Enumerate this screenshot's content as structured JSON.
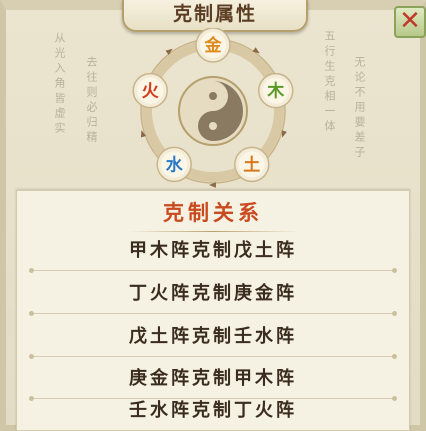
{
  "title": "克制属性",
  "close_label": "✕",
  "side_texts": [
    "从光入角皆虚实",
    "去往则必归精",
    "五行生克相一体",
    "无论不用要差子"
  ],
  "elements": [
    {
      "label": "金",
      "color": "#e08a1c",
      "icon": "metal-element-icon"
    },
    {
      "label": "木",
      "color": "#5b9a2a",
      "icon": "wood-element-icon"
    },
    {
      "label": "土",
      "color": "#d8781c",
      "icon": "earth-element-icon"
    },
    {
      "label": "水",
      "color": "#2a78c8",
      "icon": "water-element-icon"
    },
    {
      "label": "火",
      "color": "#d23a1c",
      "icon": "fire-element-icon"
    }
  ],
  "relations": {
    "heading": "克制关系",
    "items": [
      "甲木阵克制戊土阵",
      "丁火阵克制庚金阵",
      "戊土阵克制壬水阵",
      "庚金阵克制甲木阵",
      "壬水阵克制丁火阵"
    ]
  }
}
